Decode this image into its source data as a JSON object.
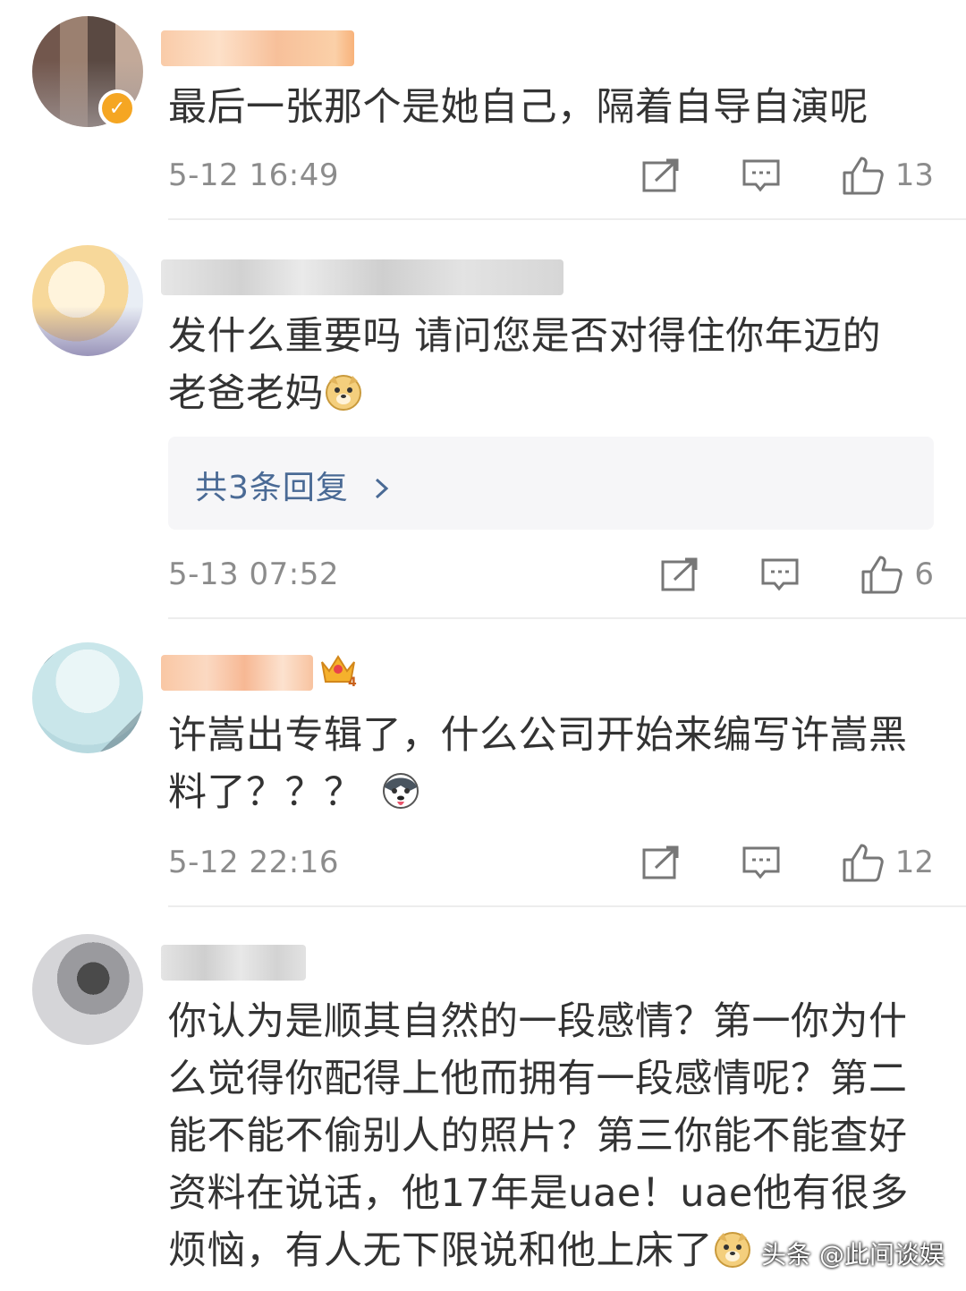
{
  "comments": [
    {
      "text": "最后一张那个是她自己，隔着自导自演呢",
      "time": "5-12 16:49",
      "likes": "13",
      "verified": true
    },
    {
      "text_line1": "发什么重要吗 请问您是否对得住你年迈的",
      "text_line2": "老爸老妈",
      "replies_label": "共3条回复",
      "time": "5-13 07:52",
      "likes": "6"
    },
    {
      "text_line1": "许嵩出专辑了，什么公司开始来编写许嵩黑",
      "text_line2": "料了？？？",
      "time": "5-12 22:16",
      "likes": "12",
      "badge_level": "4"
    },
    {
      "lines": [
        "你认为是顺其自然的一段感情？第一你为什",
        "么觉得你配得上他而拥有一段感情呢？第二",
        "能不能不偷别人的照片？第三你能不能查好",
        "资料在说话，他17年是uae！uae他有很多",
        "烦恼，有人无下限说和他上床了"
      ]
    }
  ],
  "watermark": "头条 @此间谈娱",
  "icons": {
    "share": "share-icon",
    "comment": "comment-icon",
    "like": "thumbs-up-icon",
    "chevron": "chevron-right-icon",
    "doge": "doge-emoji-icon",
    "husky": "husky-emoji-icon",
    "crown": "crown-badge-icon"
  },
  "colors": {
    "text": "#333333",
    "meta": "#8c8c8c",
    "link": "#4a6a95",
    "verified": "#f5a623"
  }
}
